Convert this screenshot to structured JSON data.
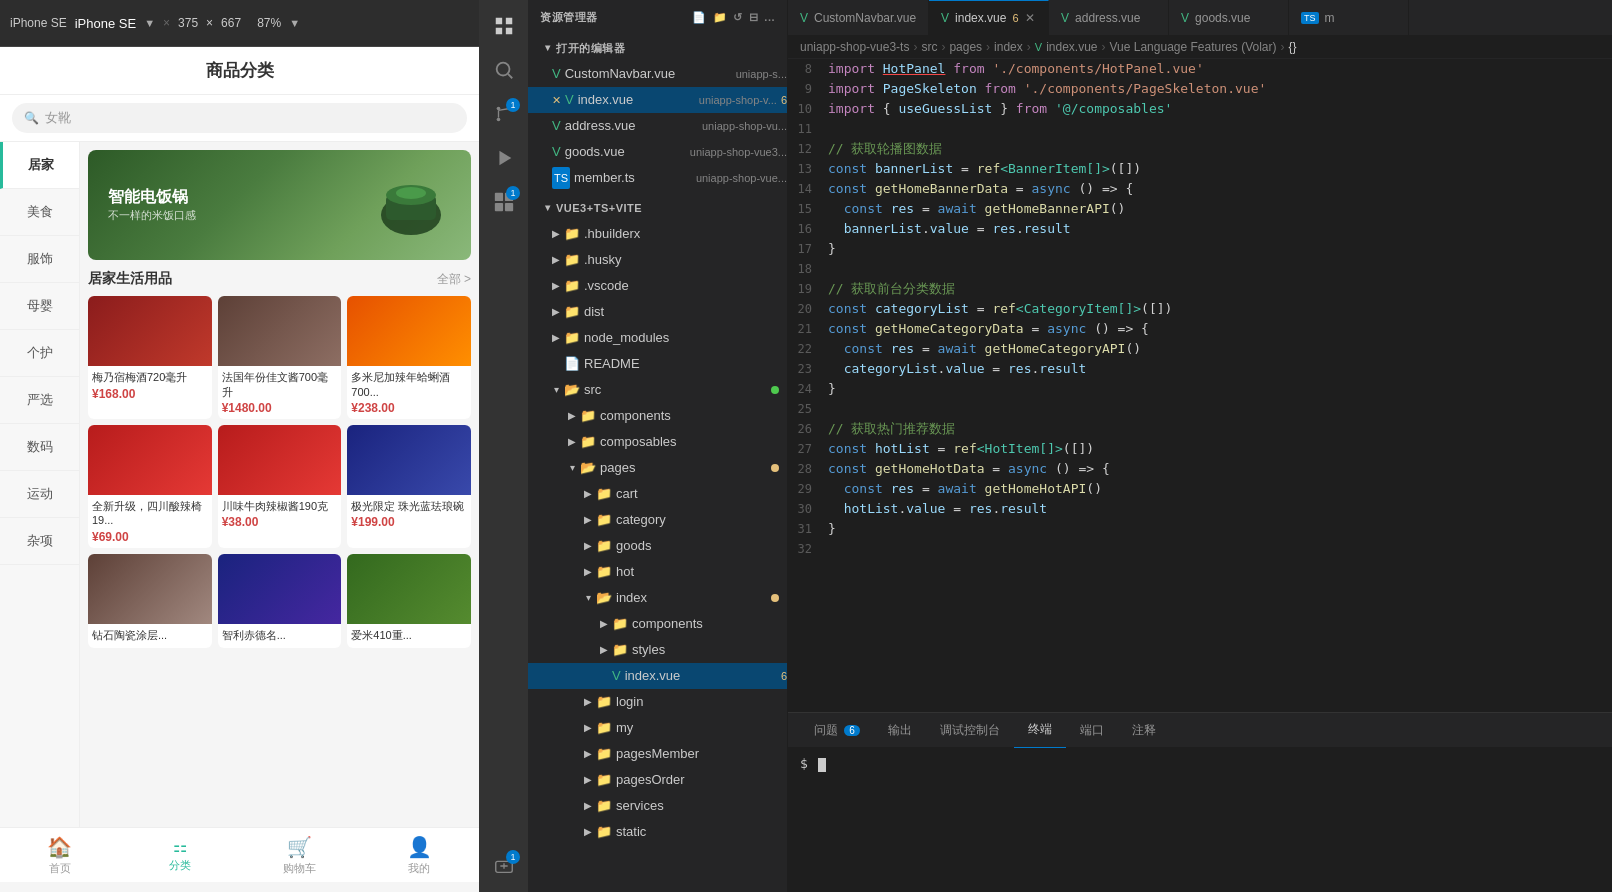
{
  "phone": {
    "device_label": "iPhone SE",
    "separator": "×",
    "width": "375",
    "height": "667",
    "zoom": "87%",
    "page_title": "商品分类",
    "search_placeholder": "女靴",
    "categories": [
      {
        "id": "home",
        "label": "居家",
        "active": true
      },
      {
        "id": "food",
        "label": "美食",
        "active": false
      },
      {
        "id": "fashion",
        "label": "服饰",
        "active": false
      },
      {
        "id": "mom",
        "label": "母婴",
        "active": false
      },
      {
        "id": "personal",
        "label": "个护",
        "active": false
      },
      {
        "id": "premium",
        "label": "严选",
        "active": false
      },
      {
        "id": "digital",
        "label": "数码",
        "active": false
      },
      {
        "id": "sports",
        "label": "运动",
        "active": false
      },
      {
        "id": "misc",
        "label": "杂项",
        "active": false
      }
    ],
    "banner": {
      "title": "智能电饭锅",
      "subtitle": "不一样的米饭口感"
    },
    "section": {
      "title": "居家生活用品",
      "more": "全部 >"
    },
    "products": [
      {
        "name": "梅乃宿梅酒720毫升",
        "price": "¥168.00",
        "img_class": "img-wine1"
      },
      {
        "name": "法国年份佳文酱700毫升",
        "price": "¥1480.00",
        "img_class": "img-wine2"
      },
      {
        "name": "多米尼加辣年蛤蜊酒700...",
        "price": "¥238.00",
        "img_class": "img-food1"
      },
      {
        "name": "全新升级，四川酸辣椅19...",
        "price": "¥69.00",
        "img_class": "img-food2"
      },
      {
        "name": "川味牛肉辣椒酱190克",
        "price": "¥38.00",
        "img_class": "img-food2"
      },
      {
        "name": "极光限定 珠光蓝珐琅碗",
        "price": "¥199.00",
        "img_class": "img-food3"
      }
    ],
    "nav": [
      {
        "id": "home",
        "icon": "🏠",
        "label": "首页",
        "active": false
      },
      {
        "id": "category",
        "icon": "⚏",
        "label": "分类",
        "active": true
      },
      {
        "id": "cart",
        "icon": "🛒",
        "label": "购物车",
        "active": false
      },
      {
        "id": "profile",
        "icon": "👤",
        "label": "我的",
        "active": false
      }
    ]
  },
  "activity_bar": {
    "icons": [
      {
        "id": "explorer",
        "symbol": "⎗",
        "label": "Explorer",
        "active": true,
        "badge": null
      },
      {
        "id": "search",
        "symbol": "⌕",
        "label": "Search",
        "active": false,
        "badge": null
      },
      {
        "id": "source-control",
        "symbol": "⎇",
        "label": "Source Control",
        "active": false,
        "badge": "1"
      },
      {
        "id": "run",
        "symbol": "▷",
        "label": "Run",
        "active": false,
        "badge": null
      },
      {
        "id": "extensions",
        "symbol": "⧉",
        "label": "Extensions",
        "active": false,
        "badge": "1"
      },
      {
        "id": "remote",
        "symbol": "⊞",
        "label": "Remote",
        "active": false,
        "badge": null
      },
      {
        "id": "account",
        "symbol": "👤",
        "label": "Account",
        "active": false,
        "badge": "1"
      }
    ]
  },
  "explorer": {
    "title": "资源管理器",
    "more_icon": "...",
    "sections": {
      "open_editors": "打开的编辑器",
      "project": "VUE3+TS+VITE"
    },
    "open_files": [
      {
        "name": "CustomNavbar.vue",
        "path": "uniapp-s...",
        "type": "vue",
        "modified": false,
        "active": false
      },
      {
        "name": "index.vue",
        "path": "uniapp-shop-v...",
        "type": "vue",
        "modified": true,
        "badge": "6",
        "active": true,
        "has_close": true
      },
      {
        "name": "address.vue",
        "path": "uniapp-shop-vu...",
        "type": "vue",
        "modified": false,
        "active": false
      },
      {
        "name": "goods.vue",
        "path": "uniapp-shop-vue3...",
        "type": "vue",
        "modified": false,
        "active": false
      },
      {
        "name": "member.ts",
        "path": "uniapp-shop-vue...",
        "type": "ts",
        "modified": false,
        "active": false
      }
    ],
    "tree": [
      {
        "level": 0,
        "type": "folder",
        "name": ".hbuilderx",
        "expanded": false
      },
      {
        "level": 0,
        "type": "folder",
        "name": ".husky",
        "expanded": false
      },
      {
        "level": 0,
        "type": "folder",
        "name": ".vscode",
        "expanded": false
      },
      {
        "level": 0,
        "type": "folder",
        "name": "dist",
        "expanded": false
      },
      {
        "level": 0,
        "type": "folder",
        "name": "node_modules",
        "expanded": false
      },
      {
        "level": 0,
        "type": "file",
        "name": "README",
        "expanded": false
      },
      {
        "level": 0,
        "type": "folder-open",
        "name": "src",
        "expanded": true,
        "dot": true
      },
      {
        "level": 1,
        "type": "folder",
        "name": "components",
        "expanded": false
      },
      {
        "level": 1,
        "type": "folder",
        "name": "composables",
        "expanded": false
      },
      {
        "level": 1,
        "type": "folder-open",
        "name": "pages",
        "expanded": true,
        "dot": true
      },
      {
        "level": 2,
        "type": "folder",
        "name": "cart",
        "expanded": false
      },
      {
        "level": 2,
        "type": "folder",
        "name": "category",
        "expanded": false
      },
      {
        "level": 2,
        "type": "folder",
        "name": "goods",
        "expanded": false
      },
      {
        "level": 2,
        "type": "folder",
        "name": "hot",
        "expanded": false
      },
      {
        "level": 2,
        "type": "folder-open",
        "name": "index",
        "expanded": true,
        "dot": true
      },
      {
        "level": 3,
        "type": "folder",
        "name": "components",
        "expanded": false
      },
      {
        "level": 3,
        "type": "folder",
        "name": "styles",
        "expanded": false
      },
      {
        "level": 3,
        "type": "vue-file",
        "name": "index.vue",
        "badge": "6",
        "active": true
      },
      {
        "level": 2,
        "type": "folder",
        "name": "login",
        "expanded": false
      },
      {
        "level": 2,
        "type": "folder",
        "name": "my",
        "expanded": false
      },
      {
        "level": 2,
        "type": "folder",
        "name": "pagesMember",
        "expanded": false
      },
      {
        "level": 2,
        "type": "folder",
        "name": "pagesOrder",
        "expanded": false
      },
      {
        "level": 2,
        "type": "folder",
        "name": "services",
        "expanded": false
      },
      {
        "level": 2,
        "type": "folder",
        "name": "static",
        "expanded": false
      }
    ]
  },
  "editor": {
    "tabs": [
      {
        "name": "CustomNavbar.vue",
        "type": "vue",
        "active": false,
        "modified": false
      },
      {
        "name": "index.vue",
        "type": "vue",
        "active": true,
        "modified": true,
        "badge": "6",
        "close": true
      },
      {
        "name": "address.vue",
        "type": "vue",
        "active": false,
        "modified": false
      },
      {
        "name": "goods.vue",
        "type": "vue",
        "active": false,
        "modified": false
      },
      {
        "name": "m",
        "type": "ts",
        "active": false,
        "modified": false
      }
    ],
    "breadcrumb": [
      "uniapp-shop-vue3-ts",
      "src",
      "pages",
      "index",
      "index.vue",
      "Vue Language Features (Volar)",
      "{}"
    ],
    "code_lines": [
      {
        "num": 8,
        "tokens": [
          {
            "t": "kw2",
            "v": "import"
          },
          {
            "t": "",
            "v": " "
          },
          {
            "t": "red-underline",
            "v": "HotPanel"
          },
          {
            "t": "",
            "v": " "
          },
          {
            "t": "kw2",
            "v": "from"
          },
          {
            "t": "",
            "v": " "
          },
          {
            "t": "str",
            "v": "'./components/HotPanel.vue'"
          }
        ]
      },
      {
        "num": 9,
        "tokens": [
          {
            "t": "kw2",
            "v": "import"
          },
          {
            "t": "",
            "v": " "
          },
          {
            "t": "var",
            "v": "PageSkeleton"
          },
          {
            "t": "",
            "v": " "
          },
          {
            "t": "kw2",
            "v": "from"
          },
          {
            "t": "",
            "v": " "
          },
          {
            "t": "str",
            "v": "'./components/PageSkeleton.vue'"
          }
        ]
      },
      {
        "num": 10,
        "tokens": [
          {
            "t": "kw2",
            "v": "import"
          },
          {
            "t": "",
            "v": " { "
          },
          {
            "t": "var",
            "v": "useGuessList"
          },
          {
            "t": "",
            "v": " } "
          },
          {
            "t": "kw2",
            "v": "from"
          },
          {
            "t": "",
            "v": " "
          },
          {
            "t": "str2",
            "v": "'@/composables'"
          }
        ]
      },
      {
        "num": 11,
        "tokens": []
      },
      {
        "num": 12,
        "tokens": [
          {
            "t": "comment",
            "v": "// 获取轮播图数据"
          }
        ]
      },
      {
        "num": 13,
        "tokens": [
          {
            "t": "kw",
            "v": "const"
          },
          {
            "t": "",
            "v": " "
          },
          {
            "t": "var",
            "v": "bannerList"
          },
          {
            "t": "",
            "v": " = "
          },
          {
            "t": "fn",
            "v": "ref"
          },
          {
            "t": "type",
            "v": "<BannerItem[]>"
          },
          {
            "t": "",
            "v": "([])"
          }
        ]
      },
      {
        "num": 14,
        "tokens": [
          {
            "t": "kw",
            "v": "const"
          },
          {
            "t": "",
            "v": " "
          },
          {
            "t": "fn",
            "v": "getHomeBannerData"
          },
          {
            "t": "",
            "v": " = "
          },
          {
            "t": "kw",
            "v": "async"
          },
          {
            "t": "",
            "v": " () => {"
          }
        ]
      },
      {
        "num": 15,
        "tokens": [
          {
            "t": "",
            "v": "  "
          },
          {
            "t": "kw",
            "v": "const"
          },
          {
            "t": "",
            "v": " "
          },
          {
            "t": "var",
            "v": "res"
          },
          {
            "t": "",
            "v": " = "
          },
          {
            "t": "kw",
            "v": "await"
          },
          {
            "t": "",
            "v": " "
          },
          {
            "t": "fn",
            "v": "getHomeBannerAPI"
          },
          {
            "t": "",
            "v": "()"
          }
        ]
      },
      {
        "num": 16,
        "tokens": [
          {
            "t": "",
            "v": "  "
          },
          {
            "t": "var",
            "v": "bannerList"
          },
          {
            "t": "",
            "v": "."
          },
          {
            "t": "var",
            "v": "value"
          },
          {
            "t": "",
            "v": " = "
          },
          {
            "t": "var",
            "v": "res"
          },
          {
            "t": "",
            "v": "."
          },
          {
            "t": "var",
            "v": "result"
          }
        ]
      },
      {
        "num": 17,
        "tokens": [
          {
            "t": "",
            "v": "}"
          }
        ]
      },
      {
        "num": 18,
        "tokens": []
      },
      {
        "num": 19,
        "tokens": [
          {
            "t": "comment",
            "v": "// 获取前台分类数据"
          }
        ]
      },
      {
        "num": 20,
        "tokens": [
          {
            "t": "kw",
            "v": "const"
          },
          {
            "t": "",
            "v": " "
          },
          {
            "t": "var",
            "v": "categoryList"
          },
          {
            "t": "",
            "v": " = "
          },
          {
            "t": "fn",
            "v": "ref"
          },
          {
            "t": "type",
            "v": "<CategoryItem[]>"
          },
          {
            "t": "",
            "v": "([])"
          }
        ]
      },
      {
        "num": 21,
        "tokens": [
          {
            "t": "kw",
            "v": "const"
          },
          {
            "t": "",
            "v": " "
          },
          {
            "t": "fn",
            "v": "getHomeCategoryData"
          },
          {
            "t": "",
            "v": " = "
          },
          {
            "t": "kw",
            "v": "async"
          },
          {
            "t": "",
            "v": " () => {"
          }
        ]
      },
      {
        "num": 22,
        "tokens": [
          {
            "t": "",
            "v": "  "
          },
          {
            "t": "kw",
            "v": "const"
          },
          {
            "t": "",
            "v": " "
          },
          {
            "t": "var",
            "v": "res"
          },
          {
            "t": "",
            "v": " = "
          },
          {
            "t": "kw",
            "v": "await"
          },
          {
            "t": "",
            "v": " "
          },
          {
            "t": "fn",
            "v": "getHomeCategoryAPI"
          },
          {
            "t": "",
            "v": "()"
          }
        ]
      },
      {
        "num": 23,
        "tokens": [
          {
            "t": "",
            "v": "  "
          },
          {
            "t": "var",
            "v": "categoryList"
          },
          {
            "t": "",
            "v": "."
          },
          {
            "t": "var",
            "v": "value"
          },
          {
            "t": "",
            "v": " = "
          },
          {
            "t": "var",
            "v": "res"
          },
          {
            "t": "",
            "v": "."
          },
          {
            "t": "var",
            "v": "result"
          }
        ]
      },
      {
        "num": 24,
        "tokens": [
          {
            "t": "",
            "v": "}"
          }
        ]
      },
      {
        "num": 25,
        "tokens": []
      },
      {
        "num": 26,
        "tokens": [
          {
            "t": "comment",
            "v": "// 获取热门推荐数据"
          }
        ]
      },
      {
        "num": 27,
        "tokens": [
          {
            "t": "kw",
            "v": "const"
          },
          {
            "t": "",
            "v": " "
          },
          {
            "t": "var",
            "v": "hotList"
          },
          {
            "t": "",
            "v": " = "
          },
          {
            "t": "fn",
            "v": "ref"
          },
          {
            "t": "type",
            "v": "<HotItem[]>"
          },
          {
            "t": "",
            "v": "([])"
          }
        ]
      },
      {
        "num": 28,
        "tokens": [
          {
            "t": "kw",
            "v": "const"
          },
          {
            "t": "",
            "v": " "
          },
          {
            "t": "fn",
            "v": "getHomeHotData"
          },
          {
            "t": "",
            "v": " = "
          },
          {
            "t": "kw",
            "v": "async"
          },
          {
            "t": "",
            "v": " () => {"
          }
        ]
      },
      {
        "num": 29,
        "tokens": [
          {
            "t": "",
            "v": "  "
          },
          {
            "t": "kw",
            "v": "const"
          },
          {
            "t": "",
            "v": " "
          },
          {
            "t": "var",
            "v": "res"
          },
          {
            "t": "",
            "v": " = "
          },
          {
            "t": "kw",
            "v": "await"
          },
          {
            "t": "",
            "v": " "
          },
          {
            "t": "fn",
            "v": "getHomeHotAPI"
          },
          {
            "t": "",
            "v": "()"
          }
        ]
      },
      {
        "num": 30,
        "tokens": [
          {
            "t": "",
            "v": "  "
          },
          {
            "t": "var",
            "v": "hotList"
          },
          {
            "t": "",
            "v": "."
          },
          {
            "t": "var",
            "v": "value"
          },
          {
            "t": "",
            "v": " = "
          },
          {
            "t": "var",
            "v": "res"
          },
          {
            "t": "",
            "v": "."
          },
          {
            "t": "var",
            "v": "result"
          }
        ]
      },
      {
        "num": 31,
        "tokens": [
          {
            "t": "",
            "v": "}"
          }
        ]
      },
      {
        "num": 32,
        "tokens": []
      }
    ]
  },
  "panel": {
    "tabs": [
      {
        "id": "problems",
        "label": "问题",
        "badge": "6"
      },
      {
        "id": "output",
        "label": "输出",
        "badge": null
      },
      {
        "id": "debug",
        "label": "调试控制台",
        "badge": null
      },
      {
        "id": "terminal",
        "label": "终端",
        "badge": null,
        "active": true
      },
      {
        "id": "ports",
        "label": "端口",
        "badge": null
      },
      {
        "id": "comments",
        "label": "注释",
        "badge": null
      }
    ],
    "terminal_prompt": "$"
  }
}
